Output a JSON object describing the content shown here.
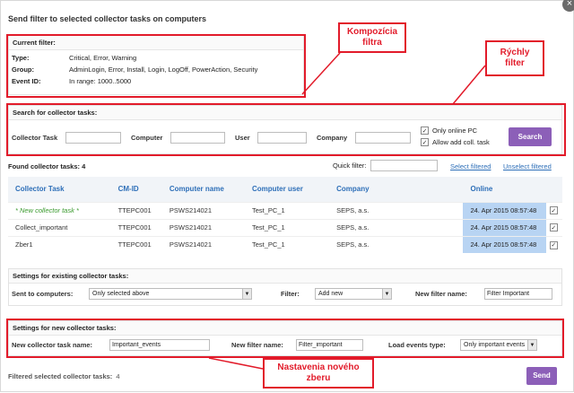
{
  "dialog": {
    "title": "Send filter to selected collector tasks on computers"
  },
  "current_filter": {
    "header": "Current filter:",
    "rows": [
      {
        "label": "Type:",
        "value": "Critical, Error, Warning"
      },
      {
        "label": "Group:",
        "value": "AdminLogin, Error, Install, Login, LogOff, PowerAction, Security"
      },
      {
        "label": "Event ID:",
        "value": "In range: 1000..5000"
      }
    ]
  },
  "search": {
    "header": "Search for collector tasks:",
    "collector_task_label": "Collector Task",
    "computer_label": "Computer",
    "user_label": "User",
    "company_label": "Company",
    "only_online_label": "Only online PC",
    "allow_add_label": "Allow add coll. task",
    "search_button": "Search"
  },
  "results": {
    "found_label": "Found collector tasks: 4",
    "quick_filter_label": "Quick filter:",
    "select_filtered": "Select filtered",
    "unselect_filtered": "Unselect filtered",
    "columns": [
      "Collector Task",
      "CM-ID",
      "Computer name",
      "Computer user",
      "Company",
      "Online"
    ],
    "rows": [
      {
        "task": "* New collector task *",
        "cmid": "TTEPC001",
        "computer": "PSWS214021",
        "user": "Test_PC_1",
        "company": "SEPS, a.s.",
        "online": "24. Apr 2015 08:57:48",
        "checked": "✓"
      },
      {
        "task": "Collect_important",
        "cmid": "TTEPC001",
        "computer": "PSWS214021",
        "user": "Test_PC_1",
        "company": "SEPS, a.s.",
        "online": "24. Apr 2015 08:57:48",
        "checked": "✓"
      },
      {
        "task": "Zber1",
        "cmid": "TTEPC001",
        "computer": "PSWS214021",
        "user": "Test_PC_1",
        "company": "SEPS, a.s.",
        "online": "24. Apr 2015 08:57:48",
        "checked": "✓"
      }
    ]
  },
  "existing": {
    "header": "Settings for existing collector tasks:",
    "sent_label": "Sent to computers:",
    "sent_value": "Only selected above",
    "filter_label": "Filter:",
    "filter_value": "Add new",
    "new_filter_label": "New filter name:",
    "new_filter_value": "Filter Important"
  },
  "new_tasks": {
    "header": "Settings for new collector tasks:",
    "task_name_label": "New collector task name:",
    "task_name_value": "Important_events",
    "filter_name_label": "New filter name:",
    "filter_name_value": "Filter_important",
    "load_type_label": "Load events type:",
    "load_type_value": "Only important events"
  },
  "footer": {
    "filtered_label": "Filtered selected collector tasks:",
    "filtered_count": "4",
    "send_button": "Send"
  },
  "callouts": {
    "composition": "Kompozícia filtra",
    "quick": "Rýchly filter",
    "new_collection": "Nastavenia nového zberu"
  },
  "colors": {
    "accent_purple": "#8c5fb8",
    "link_blue": "#2e6fb8",
    "annotation_red": "#e21b2a",
    "online_cell": "#b8d4f3",
    "new_task_green": "#3a9a2e"
  },
  "icons": {
    "close": "close-icon",
    "dropdown": "chevron-down-icon",
    "checkbox": "checkbox-icon"
  }
}
